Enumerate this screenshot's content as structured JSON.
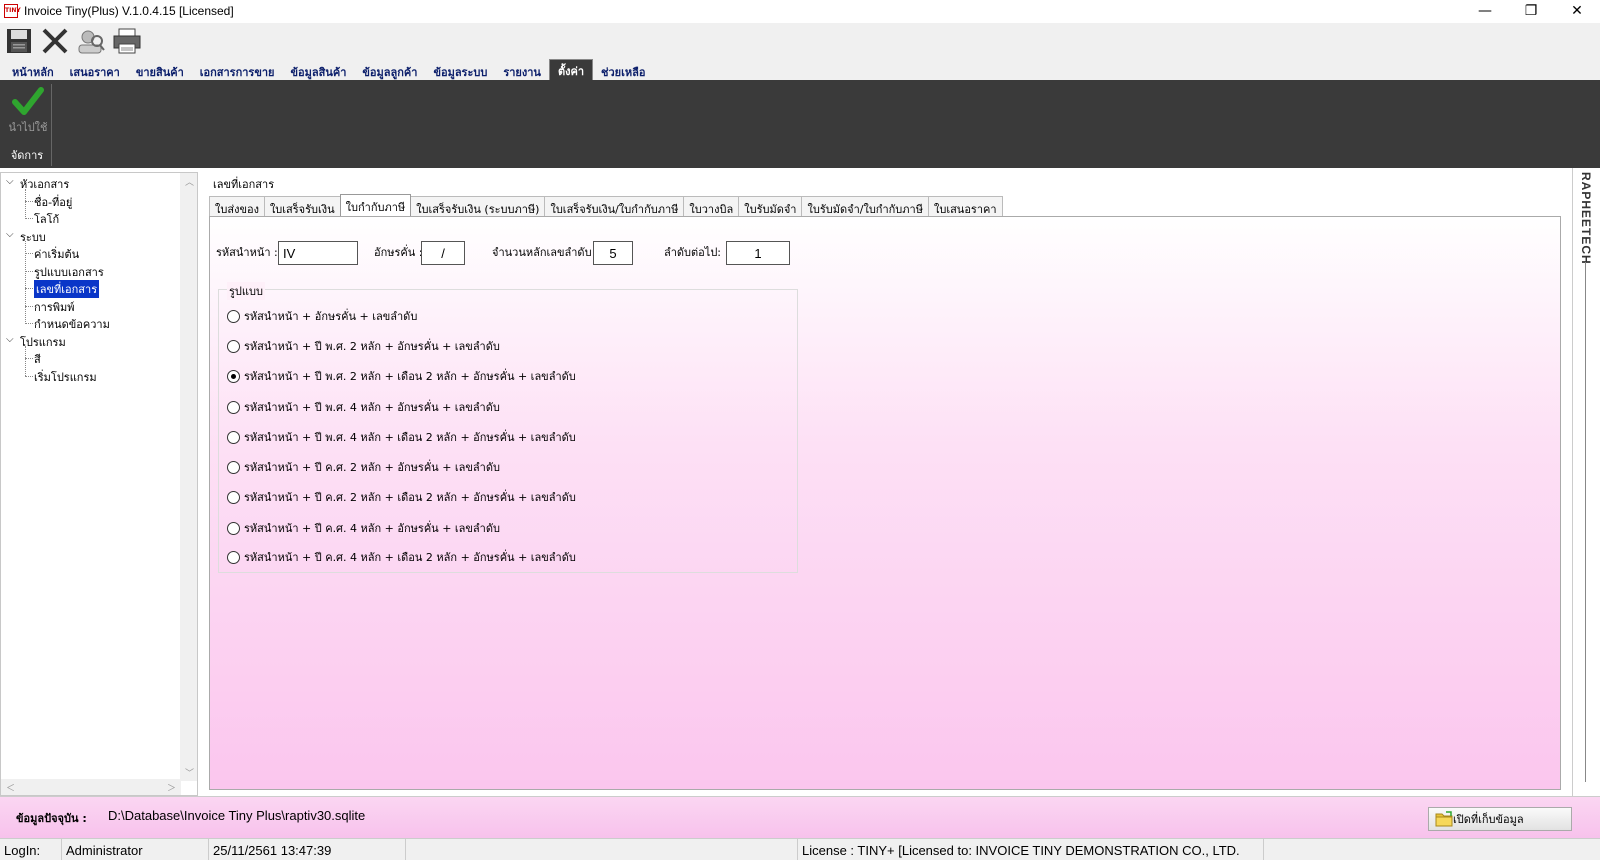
{
  "window": {
    "title": "Invoice Tiny(Plus)  V.1.0.4.15 [Licensed]",
    "app_icon_text": "TINY",
    "minimize": "—",
    "restore": "❐",
    "close": "✕"
  },
  "toolbar": {
    "icons": [
      "save-icon",
      "close-icon",
      "search-user-icon",
      "print-icon"
    ]
  },
  "menu": {
    "items": [
      "หน้าหลัก",
      "เสนอราคา",
      "ขายสินค้า",
      "เอกสารการขาย",
      "ข้อมูลสินค้า",
      "ข้อมูลลูกค้า",
      "ข้อมูลระบบ",
      "รายงาน",
      "ตั้งค่า",
      "ช่วยเหลือ"
    ],
    "active_index": 8
  },
  "ribbon": {
    "apply_label": "นำไปใช้",
    "group_label": "จัดการ"
  },
  "tree": {
    "groups": [
      {
        "label": "หัวเอกสาร",
        "children": [
          "ชื่อ-ที่อยู่",
          "โลโก้"
        ]
      },
      {
        "label": "ระบบ",
        "children": [
          "ค่าเริ่มต้น",
          "รูปแบบเอกสาร",
          "เลขที่เอกสาร",
          "การพิมพ์",
          "กำหนดข้อความ"
        ]
      },
      {
        "label": "โปรแกรม",
        "children": [
          "สี",
          "เริ่มโปรแกรม"
        ]
      }
    ],
    "selected": "เลขที่เอกสาร"
  },
  "main": {
    "group_title": "เลขที่เอกสาร",
    "tabs": [
      "ใบส่งของ",
      "ใบเสร็จรับเงิน",
      "ใบกำกับภาษี",
      "ใบเสร็จรับเงิน (ระบบภาษี)",
      "ใบเสร็จรับเงิน/ใบกำกับภาษี",
      "ใบวางบิล",
      "ใบรับมัดจำ",
      "ใบรับมัดจำ/ใบกำกับภาษี",
      "ใบเสนอราคา"
    ],
    "active_tab": 2,
    "fields": {
      "prefix_label": "รหัสนำหน้า :",
      "prefix_value": "IV",
      "separator_label": "อักษรคั่น :",
      "separator_value": "/",
      "digits_label": "จำนวนหลักเลขลำดับ :",
      "digits_value": "5",
      "next_label": "ลำดับต่อไป:",
      "next_value": "1"
    },
    "format_title": "รูปแบบ",
    "formats": [
      "รหัสนำหน้า + อักษรคั่น + เลขลำดับ",
      "รหัสนำหน้า + ปี พ.ศ. 2 หลัก + อักษรคั่น + เลขลำดับ",
      "รหัสนำหน้า + ปี พ.ศ. 2 หลัก + เดือน 2 หลัก + อักษรคั่น + เลขลำดับ",
      "รหัสนำหน้า + ปี พ.ศ. 4 หลัก + อักษรคั่น + เลขลำดับ",
      "รหัสนำหน้า + ปี พ.ศ. 4 หลัก + เดือน 2 หลัก + อักษรคั่น + เลขลำดับ",
      "รหัสนำหน้า + ปี ค.ศ. 2 หลัก + อักษรคั่น + เลขลำดับ",
      "รหัสนำหน้า + ปี ค.ศ. 2 หลัก + เดือน 2 หลัก + อักษรคั่น + เลขลำดับ",
      "รหัสนำหน้า + ปี ค.ศ. 4 หลัก + อักษรคั่น + เลขลำดับ",
      "รหัสนำหน้า + ปี ค.ศ. 4 หลัก + เดือน 2 หลัก + อักษรคั่น + เลขลำดับ"
    ],
    "selected_format": 2
  },
  "side_brand": "RAPHEETECH",
  "database": {
    "label": "ข้อมูลปัจจุบัน :",
    "path": "D:\\Database\\Invoice Tiny Plus\\raptiv30.sqlite",
    "open_button": "เปิดที่เก็บข้อมูล"
  },
  "status": {
    "login_label": "LogIn:",
    "user": "Administrator",
    "datetime": "25/11/2561 13:47:39",
    "license": "License : TINY+ [Licensed to: INVOICE TINY DEMONSTRATION CO., LTD."
  },
  "colors": {
    "ribbon_bg": "#3a3a3a",
    "menu_text": "#0c1f6b",
    "selection": "#0a36c8",
    "pink_light": "#fde0f5",
    "pink": "#fbc6ee",
    "check_green": "#2fa52f"
  }
}
